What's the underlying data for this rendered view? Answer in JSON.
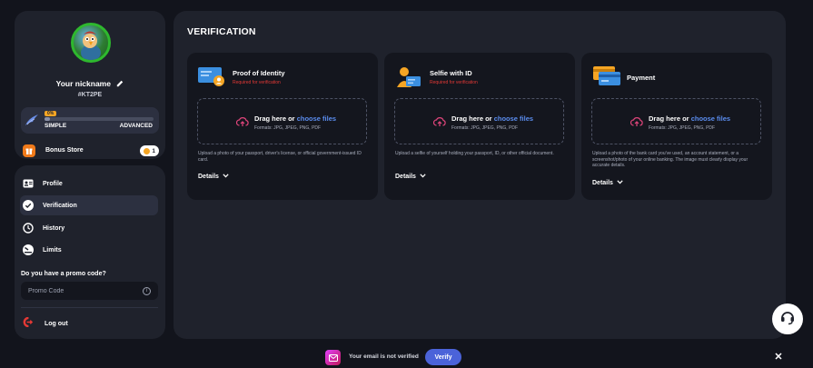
{
  "profile": {
    "nickname": "Your nickname",
    "user_id": "#KT2PE",
    "level": {
      "badge": "0%",
      "from": "SIMPLE",
      "to": "ADVANCED",
      "progress_percent": 5
    },
    "bonus_store": {
      "label": "Bonus Store",
      "count": "1"
    }
  },
  "nav": {
    "items": [
      {
        "label": "Profile",
        "icon": "id-card-icon"
      },
      {
        "label": "Verification",
        "icon": "check-circle-icon",
        "active": true
      },
      {
        "label": "History",
        "icon": "history-icon"
      },
      {
        "label": "Limits",
        "icon": "gauge-icon"
      }
    ],
    "promo": {
      "label": "Do you have a promo code?",
      "placeholder": "Promo Code"
    },
    "logout_label": "Log out"
  },
  "main": {
    "title": "VERIFICATION",
    "cards": [
      {
        "title": "Proof of Identity",
        "required": "Required for verification",
        "drop_text": "Drag here or ",
        "drop_link": "choose files",
        "formats": "Formats: JPG, JPEG, PNG, PDF",
        "description": "Upload a photo of your passport, driver's license, or official government-issued ID card.",
        "details": "Details"
      },
      {
        "title": "Selfie with ID",
        "required": "Required for verification",
        "drop_text": "Drag here or ",
        "drop_link": "choose files",
        "formats": "Formats: JPG, JPEG, PNG, PDF",
        "description": "Upload a selfie of yourself holding your passport, ID, or other official document.",
        "details": "Details"
      },
      {
        "title": "Payment",
        "drop_text": "Drag here or ",
        "drop_link": "choose files",
        "formats": "Formats: JPG, JPEG, PNG, PDF",
        "description": "Upload a photo of the bank card you've used, an account statement, or a screenshot/photo of your online banking. The image must clearly display your accurate details.",
        "details": "Details"
      }
    ]
  },
  "bottom_bar": {
    "message": "Your email is not verified",
    "verify_label": "Verify",
    "close": "✕"
  },
  "colors": {
    "background": "#12141c",
    "panel": "#1f222c",
    "card": "#14161e",
    "accent_link": "#5b8def",
    "verify_button": "#4b63d9",
    "required_text": "#e53935",
    "level_badge": "#f5a524",
    "bonus": "#f07a1a"
  }
}
